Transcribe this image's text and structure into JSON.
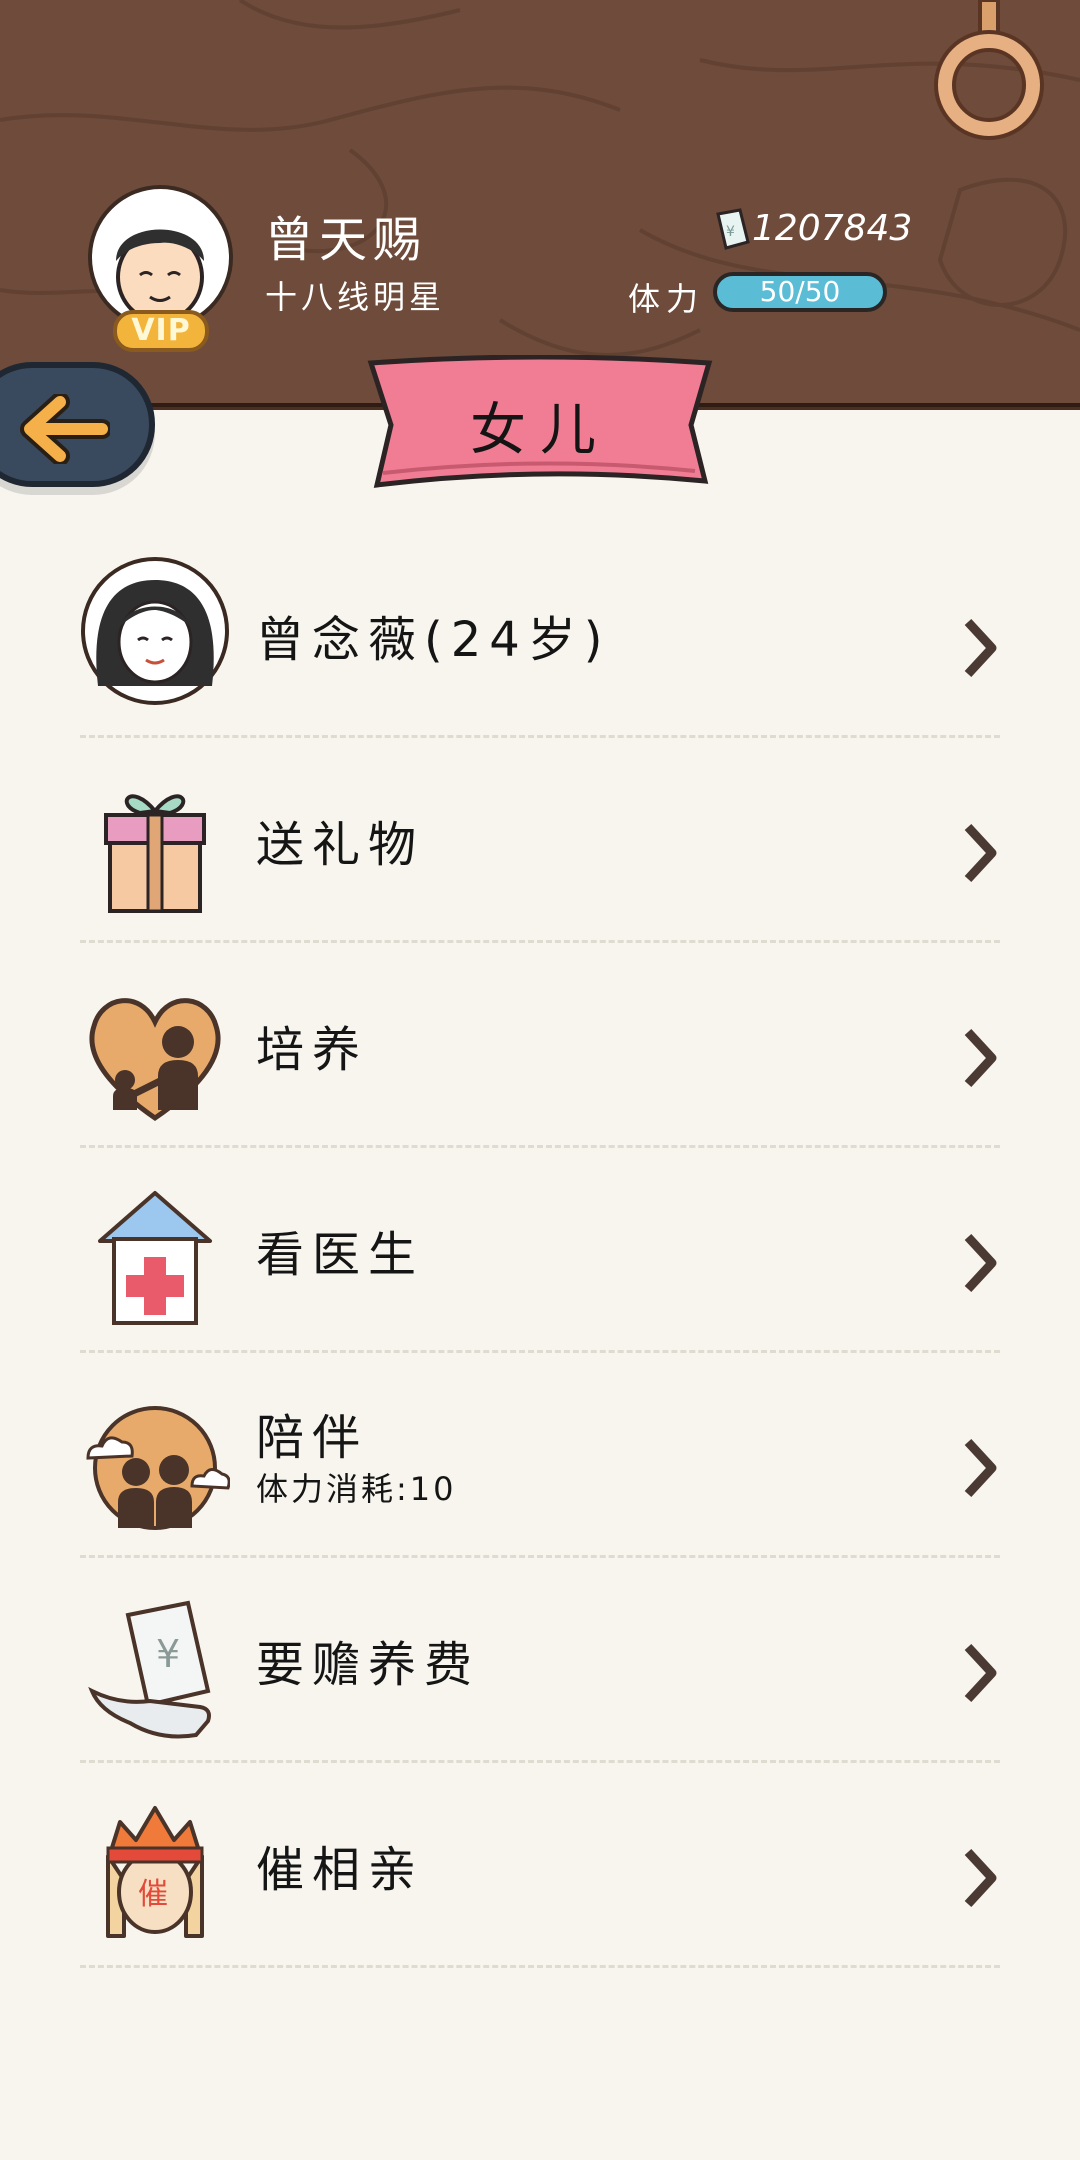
{
  "player": {
    "name": "曾天赐",
    "title": "十八线明星",
    "vip_badge": "VIP",
    "money": "1207843",
    "stamina_label": "体力",
    "stamina_value": "50/50"
  },
  "page_title": "女儿",
  "menu": [
    {
      "label": "曾念薇(24岁)",
      "icon": "daughter-portrait-icon"
    },
    {
      "label": "送礼物",
      "icon": "gift-box-icon"
    },
    {
      "label": "培养",
      "icon": "heart-parent-child-icon"
    },
    {
      "label": "看医生",
      "icon": "hospital-icon"
    },
    {
      "label": "陪伴",
      "sub": "体力消耗:10",
      "icon": "companions-icon"
    },
    {
      "label": "要赡养费",
      "icon": "money-bill-hand-icon"
    },
    {
      "label": "催相亲",
      "icon": "urge-matchmaking-icon",
      "icon_text": "催"
    }
  ],
  "colors": {
    "wood": "#6e4b3a",
    "banner_pink": "#f07d93",
    "stamina_blue": "#5bbcd6",
    "back_button": "#39495e",
    "vip_gold": "#f2b43b"
  }
}
